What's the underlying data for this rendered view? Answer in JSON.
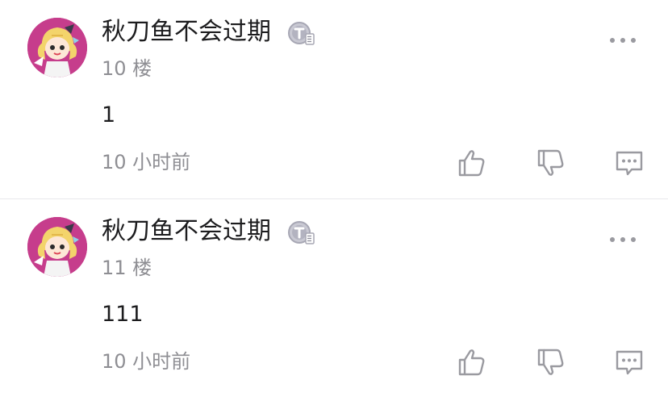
{
  "comments": [
    {
      "username": "秋刀鱼不会过期",
      "floor": "10 楼",
      "content": "1",
      "time": "10 小时前",
      "level_badge_icon": "level-badge-icon",
      "avatar_background": "#c63d8c"
    },
    {
      "username": "秋刀鱼不会过期",
      "floor": "11 楼",
      "content": "111",
      "time": "10 小时前",
      "level_badge_icon": "level-badge-icon",
      "avatar_background": "#c63d8c"
    }
  ],
  "colors": {
    "text_primary": "#1c1c1e",
    "text_secondary": "#8e8e93",
    "divider": "#e9e9ec",
    "icon_gray": "#9a9aa0"
  }
}
